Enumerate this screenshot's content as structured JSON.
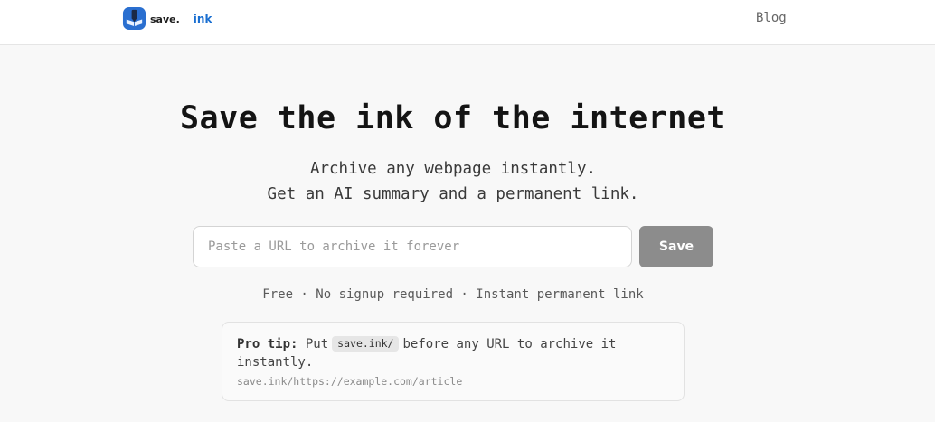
{
  "header": {
    "logo_text_part1": "save.",
    "logo_text_part2": "ink",
    "nav_blog": "Blog"
  },
  "hero": {
    "title": "Save the ink of the internet",
    "subtitle_line1": "Archive any webpage instantly.",
    "subtitle_line2": "Get an AI summary and a permanent link."
  },
  "archive_form": {
    "url_placeholder": "Paste a URL to archive it forever",
    "url_value": "",
    "save_label": "Save"
  },
  "features": {
    "text": "Free · No signup required · Instant permanent link"
  },
  "pro_tip": {
    "label": "Pro tip:",
    "before_code": "Put",
    "code": "save.ink/",
    "after_code": "before any URL to archive it instantly.",
    "example": "save.ink/https://example.com/article"
  },
  "colors": {
    "accent": "#1a6fd1",
    "save_button": "#8c8c8c",
    "background": "#f8f8f8"
  },
  "icons": {
    "logo": "save-ink-logo-icon"
  }
}
